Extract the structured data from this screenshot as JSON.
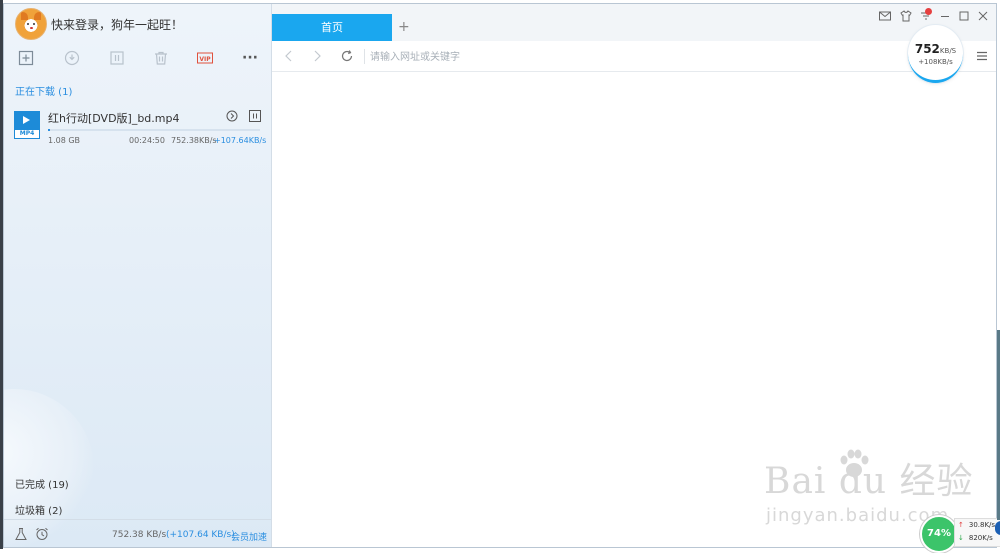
{
  "login": {
    "text": "快来登录，狗年一起旺！"
  },
  "toolbar": {
    "icons": [
      "add-icon",
      "info-icon",
      "pause-icon",
      "trash-icon",
      "vip-icon",
      "more-icon"
    ],
    "more_label": "···",
    "vip_label": "VIP"
  },
  "sections": {
    "downloading": "正在下载 (1)",
    "completed": "已完成 (19)",
    "trash": "垃圾箱 (2)"
  },
  "downloads": [
    {
      "file_name": "红h行动[DVD版]_bd.mp4",
      "ext_label": "MP4",
      "size": "1.08 GB",
      "time_left": "00:24:50",
      "speed": "752.38KB/s",
      "accel": "+107.64KB/s",
      "progress": 0.01
    }
  ],
  "status": {
    "speed": "752.38 KB/s",
    "accel": "(+107.64 KB/s)",
    "vip_link": "会员加速"
  },
  "browser": {
    "tab_title": "首页",
    "new_tab": "+",
    "url_placeholder": "请输入网址或关键字",
    "speed_main": "752",
    "speed_unit": "KB/S",
    "speed_sub": "+108KB/s"
  },
  "watermark": {
    "brand": "Bai  du 经验",
    "url": "jingyan.baidu.com"
  },
  "system": {
    "percent": "74%",
    "up": "30.8K/s",
    "down": "820K/s"
  },
  "colors": {
    "accent": "#1aa7ef",
    "link": "#2a8ee0",
    "badge_green": "#3cc46a"
  }
}
